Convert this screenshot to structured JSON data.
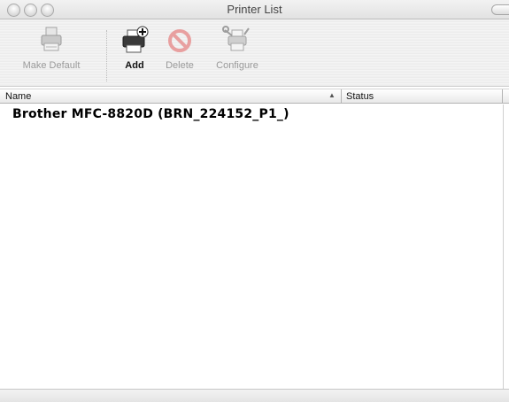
{
  "window": {
    "title": "Printer List"
  },
  "toolbar": {
    "make_default_label": "Make Default",
    "add_label": "Add",
    "delete_label": "Delete",
    "configure_label": "Configure"
  },
  "columns": {
    "name_label": "Name",
    "status_label": "Status",
    "sort_indicator": "▲"
  },
  "printers": [
    {
      "name": "Brother MFC-8820D (BRN_224152_P1_)",
      "status": ""
    }
  ],
  "colors": {
    "delete_icon": "#e8a0a0",
    "disabled_text": "#9a9a9a"
  }
}
